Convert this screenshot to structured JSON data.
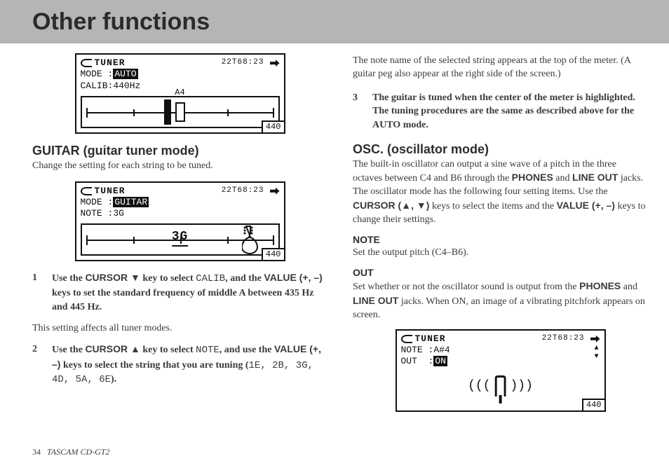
{
  "header": {
    "title": "Other functions"
  },
  "lcd_auto": {
    "title": "TUNER",
    "time": "22T68:23",
    "mode_label": "MODE :",
    "mode_value": "AUTO",
    "calib_label": "CALIB:",
    "calib_value": "440Hz",
    "note": "A4",
    "badge": "440"
  },
  "guitar": {
    "heading": "GUITAR (guitar tuner mode)",
    "intro": "Change the setting for each string to be tuned."
  },
  "lcd_guitar": {
    "title": "TUNER",
    "time": "22T68:23",
    "mode_label": "MODE :",
    "mode_value": "GUITAR",
    "note_label": "NOTE :",
    "note_value": "3G",
    "big_note": "3G",
    "badge": "440"
  },
  "step1": {
    "pre": "Use the ",
    "key": "CURSOR ▼",
    "mid1": " key to select ",
    "code": "CALIB",
    "mid2": ", and the ",
    "keys2": "VALUE (+, –)",
    "tail": " keys to set the standard frequency of middle A between 435 Hz and 445 Hz."
  },
  "after_step1": "This setting affects all tuner modes.",
  "step2": {
    "pre": "Use the ",
    "key": "CURSOR ▲",
    "mid1": " key to select ",
    "code": "NOTE",
    "mid2": ", and use the ",
    "keys2": "VALUE (+, –)",
    "mid3": " keys to select the string that you are tuning (",
    "strings": "1E, 2B, 3G, 4D, 5A, 6E",
    "tail": ")."
  },
  "rcol_intro": "The note name of the selected string appears at the top of the meter. (A guitar peg also appear at the right side of the screen.)",
  "step3": {
    "text": "The guitar is tuned when the center of the meter is highlighted. The tuning procedures are the same as described above for the AUTO mode."
  },
  "osc": {
    "heading": "OSC. (oscillator mode)",
    "p_pre": "The built-in oscillator can output a sine wave of a pitch in the three octaves between C4 and B6 through the ",
    "phones": "PHONES",
    "and": " and ",
    "lineout": "LINE OUT",
    "p_mid": " jacks. The oscillator mode has the following four setting items. Use the ",
    "cursor": "CURSOR (▲, ▼)",
    "p_mid2": " keys to select the items and the ",
    "value": "VALUE (+, –)",
    "p_tail": " keys to change their settings."
  },
  "note_section": {
    "heading": "NOTE",
    "body": "Set the output pitch (C4–B6)."
  },
  "out_section": {
    "heading": "OUT",
    "p_pre": "Set whether or not the oscillator sound is output from the ",
    "phones": "PHONES",
    "and": " and ",
    "lineout": "LINE OUT",
    "p_tail": " jacks. When ON, an image of a vibrating pitchfork appears on screen."
  },
  "lcd_osc": {
    "title": "TUNER",
    "time": "22T68:23",
    "note_label": "NOTE :",
    "note_value": "A#4",
    "out_label": "OUT  :",
    "out_value": "ON",
    "badge": "440",
    "waves_l": "(((",
    "waves_r": ")))"
  },
  "footer": {
    "page": "34",
    "product": "TASCAM  CD-GT2"
  }
}
